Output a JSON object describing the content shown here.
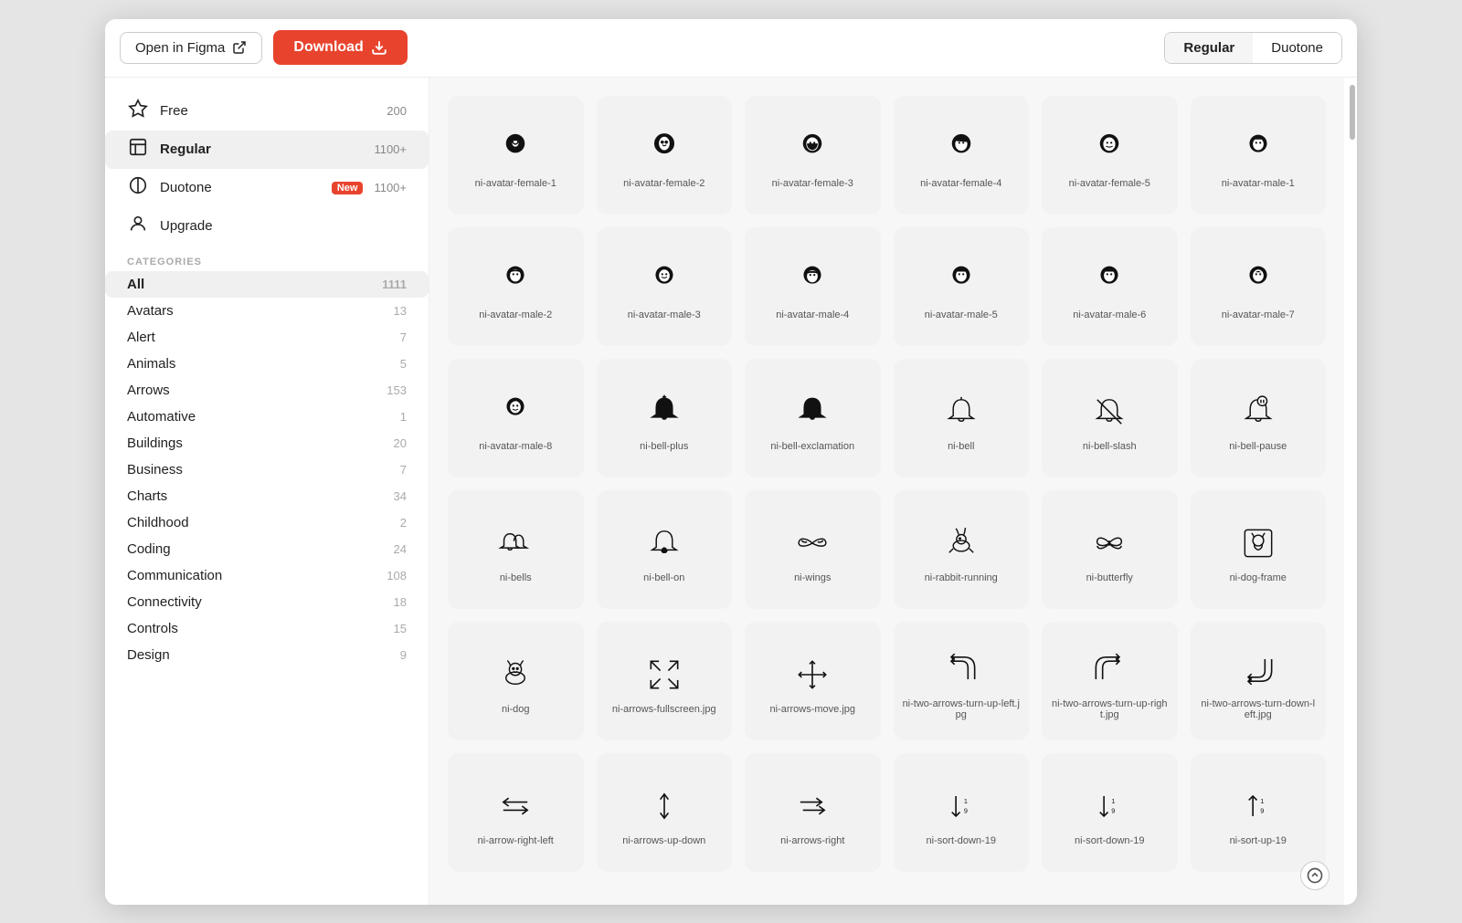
{
  "titlebar": {
    "open_figma_label": "Open in Figma",
    "download_label": "Download",
    "view_regular": "Regular",
    "view_duotone": "Duotone"
  },
  "sidebar": {
    "tiers": [
      {
        "id": "free",
        "icon": "🏷️",
        "label": "Free",
        "count": "200"
      },
      {
        "id": "regular",
        "icon": "🏠",
        "label": "Regular",
        "count": "1100+"
      },
      {
        "id": "duotone",
        "icon": "🏠",
        "label": "Duotone",
        "badge": "New",
        "count": "1100+"
      },
      {
        "id": "upgrade",
        "icon": "⭐",
        "label": "Upgrade",
        "count": ""
      }
    ],
    "categories_label": "CATEGORIES",
    "categories": [
      {
        "id": "all",
        "label": "All",
        "count": "1111",
        "active": true
      },
      {
        "id": "avatars",
        "label": "Avatars",
        "count": "13"
      },
      {
        "id": "alert",
        "label": "Alert",
        "count": "7"
      },
      {
        "id": "animals",
        "label": "Animals",
        "count": "5"
      },
      {
        "id": "arrows",
        "label": "Arrows",
        "count": "153"
      },
      {
        "id": "automative",
        "label": "Automative",
        "count": "1"
      },
      {
        "id": "buildings",
        "label": "Buildings",
        "count": "20"
      },
      {
        "id": "business",
        "label": "Business",
        "count": "7"
      },
      {
        "id": "charts",
        "label": "Charts",
        "count": "34"
      },
      {
        "id": "childhood",
        "label": "Childhood",
        "count": "2"
      },
      {
        "id": "coding",
        "label": "Coding",
        "count": "24"
      },
      {
        "id": "communication",
        "label": "Communication",
        "count": "108"
      },
      {
        "id": "connectivity",
        "label": "Connectivity",
        "count": "18"
      },
      {
        "id": "controls",
        "label": "Controls",
        "count": "15"
      },
      {
        "id": "design",
        "label": "Design",
        "count": "9"
      }
    ]
  },
  "icons": [
    {
      "id": "ni-avatar-female-1",
      "label": "ni-avatar-female-1",
      "shape": "avatar-female-1"
    },
    {
      "id": "ni-avatar-female-2",
      "label": "ni-avatar-female-2",
      "shape": "avatar-female-2"
    },
    {
      "id": "ni-avatar-female-3",
      "label": "ni-avatar-female-3",
      "shape": "avatar-female-3"
    },
    {
      "id": "ni-avatar-female-4",
      "label": "ni-avatar-female-4",
      "shape": "avatar-female-4"
    },
    {
      "id": "ni-avatar-female-5",
      "label": "ni-avatar-female-5",
      "shape": "avatar-female-5"
    },
    {
      "id": "ni-avatar-male-1",
      "label": "ni-avatar-male-1",
      "shape": "avatar-male-1"
    },
    {
      "id": "ni-avatar-male-2",
      "label": "ni-avatar-male-2",
      "shape": "avatar-male-2"
    },
    {
      "id": "ni-avatar-male-3",
      "label": "ni-avatar-male-3",
      "shape": "avatar-male-3"
    },
    {
      "id": "ni-avatar-male-4",
      "label": "ni-avatar-male-4",
      "shape": "avatar-male-4"
    },
    {
      "id": "ni-avatar-male-5",
      "label": "ni-avatar-male-5",
      "shape": "avatar-male-5"
    },
    {
      "id": "ni-avatar-male-6",
      "label": "ni-avatar-male-6",
      "shape": "avatar-male-6"
    },
    {
      "id": "ni-avatar-male-7",
      "label": "ni-avatar-male-7",
      "shape": "avatar-male-7"
    },
    {
      "id": "ni-avatar-male-8",
      "label": "ni-avatar-male-8",
      "shape": "avatar-male-8"
    },
    {
      "id": "ni-bell-plus",
      "label": "ni-bell-plus",
      "shape": "bell-plus"
    },
    {
      "id": "ni-bell-exclamation",
      "label": "ni-bell-exclamation",
      "shape": "bell-exclamation"
    },
    {
      "id": "ni-bell",
      "label": "ni-bell",
      "shape": "bell"
    },
    {
      "id": "ni-bell-slash",
      "label": "ni-bell-slash",
      "shape": "bell-slash"
    },
    {
      "id": "ni-bell-pause",
      "label": "ni-bell-pause",
      "shape": "bell-pause"
    },
    {
      "id": "ni-bells",
      "label": "ni-bells",
      "shape": "bells"
    },
    {
      "id": "ni-bell-on",
      "label": "ni-bell-on",
      "shape": "bell-on"
    },
    {
      "id": "ni-wings",
      "label": "ni-wings",
      "shape": "wings"
    },
    {
      "id": "ni-rabbit-running",
      "label": "ni-rabbit-running",
      "shape": "rabbit-running"
    },
    {
      "id": "ni-butterfly",
      "label": "ni-butterfly",
      "shape": "butterfly"
    },
    {
      "id": "ni-dog-frame",
      "label": "ni-dog-frame",
      "shape": "dog-frame"
    },
    {
      "id": "ni-dog",
      "label": "ni-dog",
      "shape": "dog"
    },
    {
      "id": "ni-arrows-fullscreen",
      "label": "ni-arrows-fullscreen.jpg",
      "shape": "arrows-fullscreen"
    },
    {
      "id": "ni-arrows-move",
      "label": "ni-arrows-move.jpg",
      "shape": "arrows-move"
    },
    {
      "id": "ni-two-arrows-turn-up-left",
      "label": "ni-two-arrows-turn-up-left.jpg",
      "shape": "arrows-turn-up-left"
    },
    {
      "id": "ni-two-arrows-turn-up-right",
      "label": "ni-two-arrows-turn-up-right.jpg",
      "shape": "arrows-turn-up-right"
    },
    {
      "id": "ni-two-arrows-turn-down-left",
      "label": "ni-two-arrows-turn-down-left.jpg",
      "shape": "arrows-turn-down-left"
    },
    {
      "id": "ni-arrow-right-left",
      "label": "ni-arrow-right-left",
      "shape": "arrow-right-left"
    },
    {
      "id": "ni-arrows-up-down",
      "label": "ni-arrows-up-down",
      "shape": "arrows-up-down"
    },
    {
      "id": "ni-arrows-right",
      "label": "ni-arrows-right",
      "shape": "arrows-right"
    },
    {
      "id": "ni-sort-down-19",
      "label": "ni-sort-down-19",
      "shape": "sort-down-19"
    },
    {
      "id": "ni-sort-down-19b",
      "label": "ni-sort-down-19",
      "shape": "sort-down-19b"
    },
    {
      "id": "ni-sort-up-19",
      "label": "ni-sort-up-19",
      "shape": "sort-up-19"
    }
  ]
}
